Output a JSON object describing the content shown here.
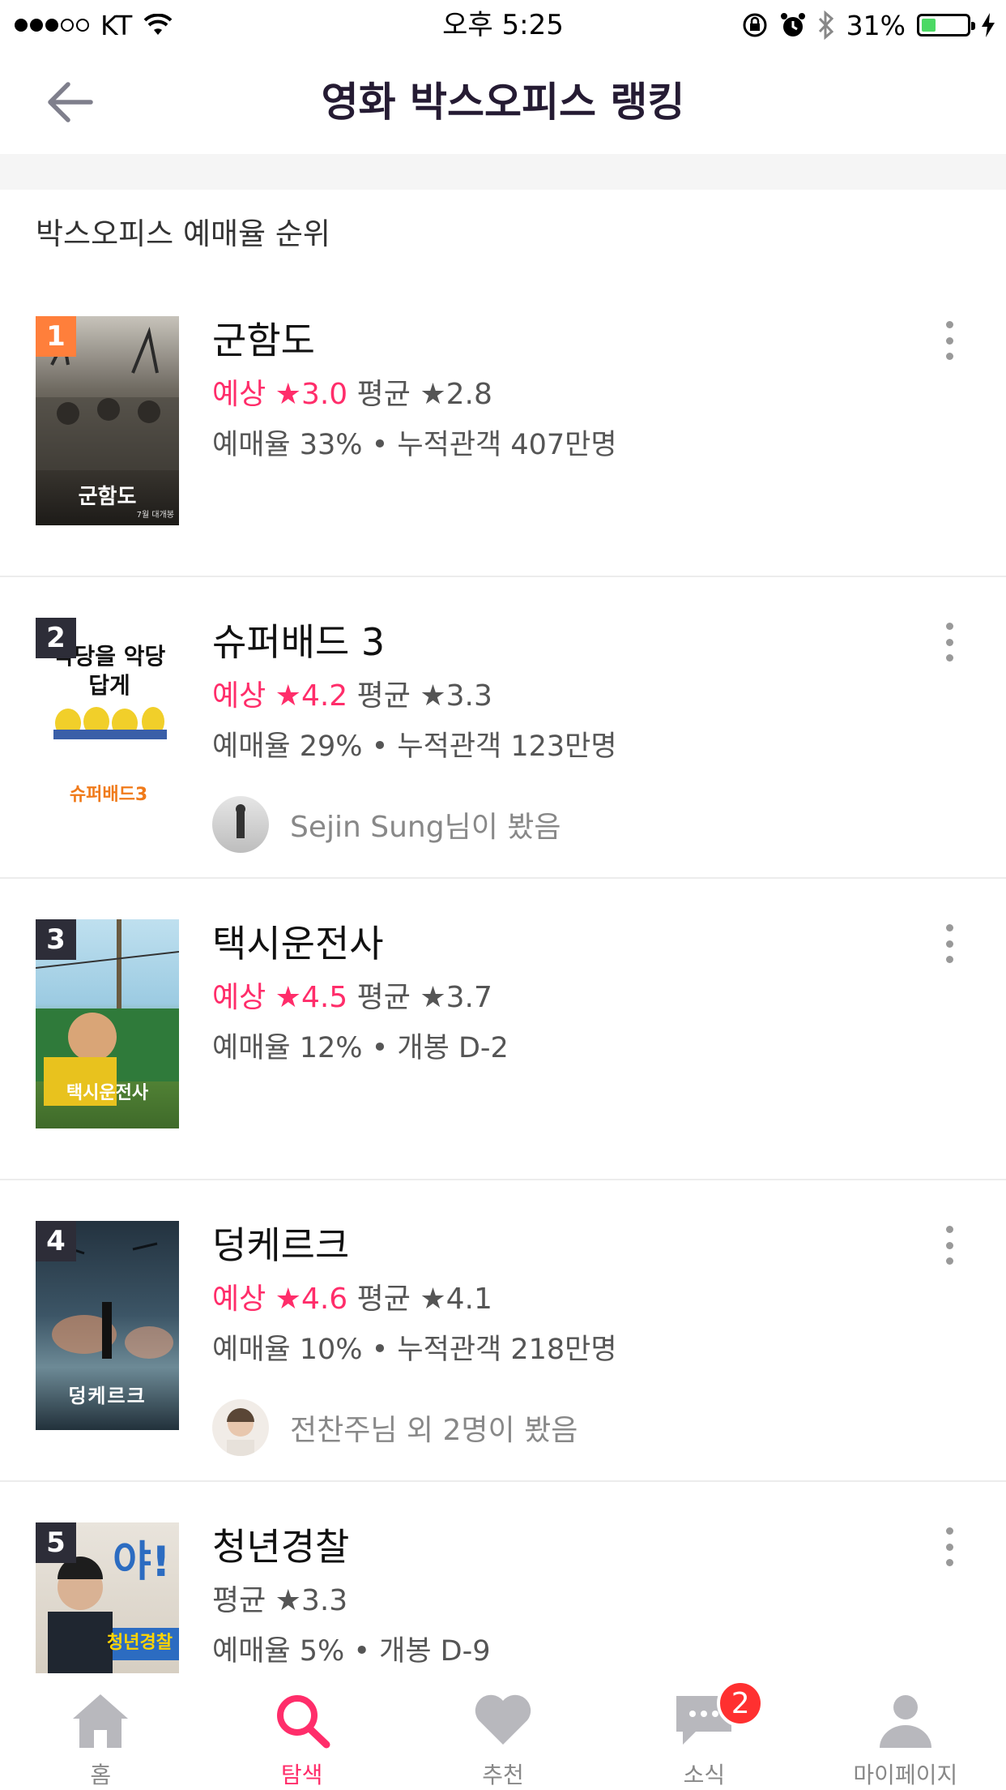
{
  "status_bar": {
    "carrier": "KT",
    "time": "오후 5:25",
    "battery_pct": "31%",
    "battery_level": 0.31,
    "signal_bars_filled": 3,
    "signal_bars_total": 5
  },
  "header": {
    "title": "영화 박스오피스 랭킹",
    "back_icon": "arrow-left-icon"
  },
  "section_title": "박스오피스 예매율 순위",
  "movies": [
    {
      "rank": "1",
      "title": "군함도",
      "expected_label": "예상 ★3.0",
      "avg_label": "평균 ★2.8",
      "stats": "예매율 33% • 누적관객 407만명",
      "poster_text": "군함도",
      "poster_sub": "7월 대개봉",
      "friend_text": ""
    },
    {
      "rank": "2",
      "title": "슈퍼배드 3",
      "expected_label": "예상 ★4.2",
      "avg_label": "평균 ★3.3",
      "stats": "예매율 29% • 누적관객 123만명",
      "poster_text": "악당을 악당답게",
      "poster_sub": "슈퍼배드3",
      "friend_text": "Sejin Sung님이 봤음"
    },
    {
      "rank": "3",
      "title": "택시운전사",
      "expected_label": "예상 ★4.5",
      "avg_label": "평균 ★3.7",
      "stats": "예매율 12% • 개봉 D-2",
      "poster_text": "택시운전사",
      "poster_sub": "",
      "friend_text": ""
    },
    {
      "rank": "4",
      "title": "덩케르크",
      "expected_label": "예상 ★4.6",
      "avg_label": "평균 ★4.1",
      "stats": "예매율 10% • 누적관객 218만명",
      "poster_text": "덩케르크",
      "poster_sub": "",
      "friend_text": "전찬주님 외 2명이 봤음"
    },
    {
      "rank": "5",
      "title": "청년경찰",
      "expected_label": "",
      "avg_label": "평균 ★3.3",
      "stats": "예매율 5% • 개봉 D-9",
      "poster_text": "청년경찰",
      "poster_sub": "야!",
      "friend_text": ""
    }
  ],
  "tab_bar": {
    "tabs": [
      {
        "label": "홈",
        "icon": "home-icon"
      },
      {
        "label": "탐색",
        "icon": "search-icon"
      },
      {
        "label": "추천",
        "icon": "heart-icon"
      },
      {
        "label": "소식",
        "icon": "chat-bubble-icon",
        "badge": "2"
      },
      {
        "label": "마이페이지",
        "icon": "person-icon"
      }
    ],
    "active_index": 1
  },
  "colors": {
    "accent": "#ff2d6a",
    "rank_first": "#ff7f3b",
    "rank_other": "#2d2d38",
    "title": "#251b33",
    "badge": "#ff3030"
  }
}
